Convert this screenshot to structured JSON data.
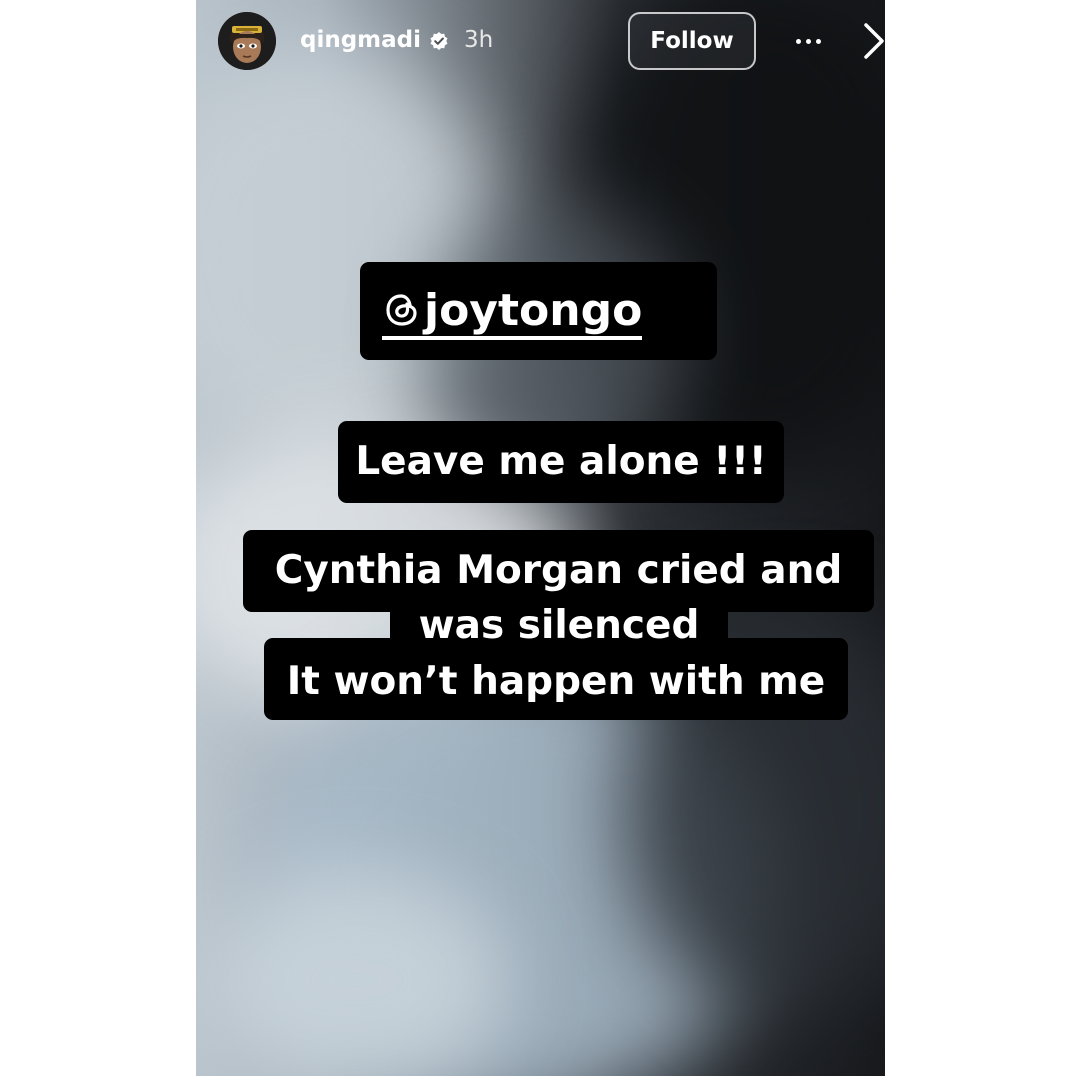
{
  "header": {
    "username": "qingmadi",
    "timestamp": "3h",
    "follow_label": "Follow",
    "verified_icon": "verified-badge-icon",
    "more_icon": "more-options-icon",
    "next_icon": "chevron-right-icon",
    "avatar_icon": "cartoon-avatar"
  },
  "stickers": {
    "mention": "joytongo",
    "mention_icon": "threads-icon",
    "leave": "Leave me alone !!!",
    "line1": "Cynthia Morgan cried and",
    "line2": "was silenced",
    "line3": "It won’t happen with me"
  },
  "colors": {
    "sticker_background": "#000000",
    "text": "#ffffff"
  }
}
